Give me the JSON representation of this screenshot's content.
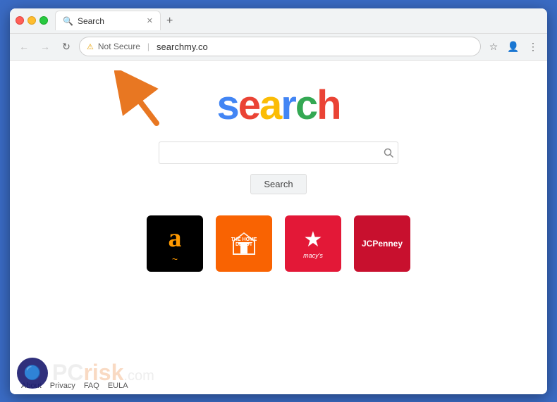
{
  "browser": {
    "tab": {
      "title": "Search",
      "favicon": "🔍"
    },
    "address": {
      "security_label": "Not Secure",
      "url": "searchmy.co"
    },
    "nav": {
      "back": "←",
      "forward": "→",
      "refresh": "↻"
    }
  },
  "page": {
    "logo": {
      "letters": [
        "s",
        "e",
        "a",
        "r",
        "c",
        "h"
      ]
    },
    "search_placeholder": "",
    "search_button_label": "Search",
    "store_logos": [
      {
        "name": "Amazon",
        "id": "amazon"
      },
      {
        "name": "The Home Depot",
        "id": "homedepot"
      },
      {
        "name": "Macy's",
        "id": "macys"
      },
      {
        "name": "JCPenney",
        "id": "jcpenney"
      }
    ],
    "footer_links": [
      "About",
      "Privacy",
      "FAQ",
      "EULA"
    ]
  },
  "icons": {
    "magnifier": "🔍",
    "star": "★",
    "arrow_right": "→",
    "not_secure_warning": "⚠"
  }
}
